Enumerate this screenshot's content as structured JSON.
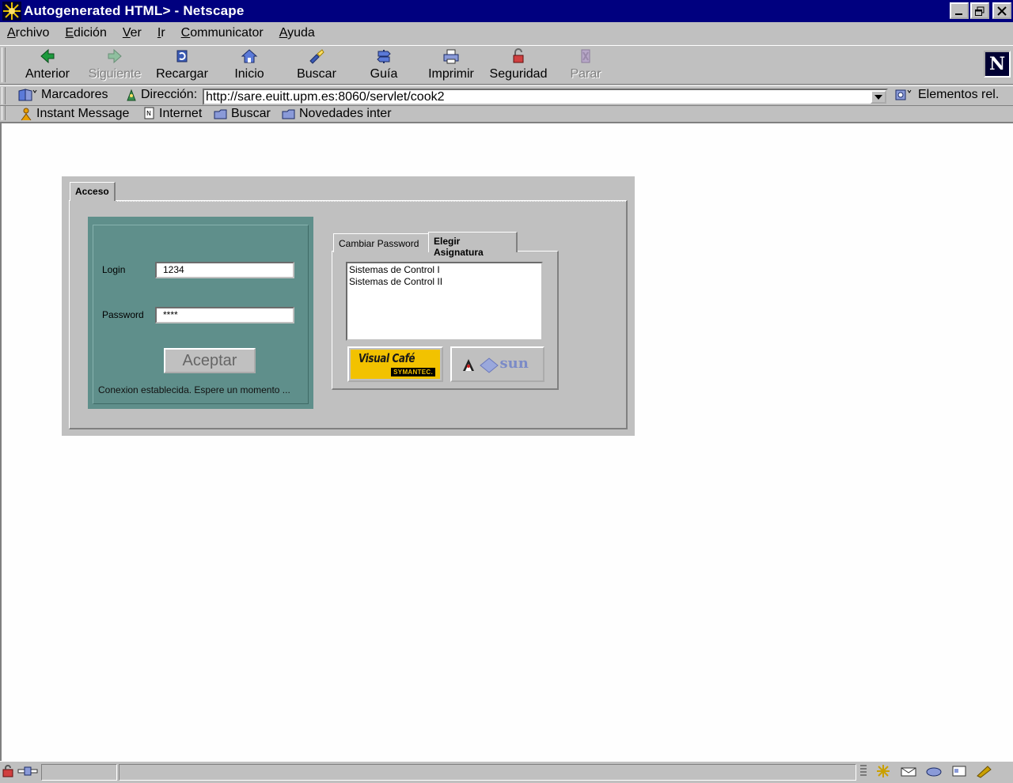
{
  "window": {
    "title": "Autogenerated HTML> - Netscape"
  },
  "menubar": {
    "items": [
      {
        "label": "Archivo",
        "mnemonic": "A",
        "rest": "rchivo"
      },
      {
        "label": "Edición",
        "mnemonic": "E",
        "rest": "dición"
      },
      {
        "label": "Ver",
        "mnemonic": "V",
        "rest": "er"
      },
      {
        "label": "Ir",
        "mnemonic": "I",
        "rest": "r"
      },
      {
        "label": "Communicator",
        "mnemonic": "C",
        "rest": "ommunicator"
      },
      {
        "label": "Ayuda",
        "mnemonic": "A",
        "rest": "yuda"
      }
    ]
  },
  "toolbar": {
    "back": "Anterior",
    "forward": "Siguiente",
    "reload": "Recargar",
    "home": "Inicio",
    "search": "Buscar",
    "guide": "Guía",
    "print": "Imprimir",
    "security": "Seguridad",
    "stop": "Parar",
    "logo": "N"
  },
  "location": {
    "bookmarks_label": "Marcadores",
    "address_label": "Dirección:",
    "url": "http://sare.euitt.upm.es:8060/servlet/cook2",
    "related_label": "Elementos rel."
  },
  "personal": {
    "items": [
      "Instant Message",
      "Internet",
      "Buscar",
      "Novedades inter"
    ]
  },
  "applet": {
    "main_tab": "Acceso",
    "login_label": "Login",
    "login_value": "1234",
    "password_label": "Password",
    "password_value": "****",
    "accept_button": "Aceptar",
    "status_message": "Conexion establecida. Espere un momento ...",
    "tabs": [
      "Cambiar Password",
      "Elegir Asignatura"
    ],
    "subjects": [
      "Sistemas de Control I",
      "Sistemas de Control II"
    ],
    "visual_cafe_text": "Visual Café",
    "symantec_text": "SYMANTEC.",
    "sun_text": "sun"
  },
  "colors": {
    "titlebar": "#00007f",
    "login_panel": "#5f8f8b",
    "visual_cafe_yellow": "#f2c200"
  }
}
